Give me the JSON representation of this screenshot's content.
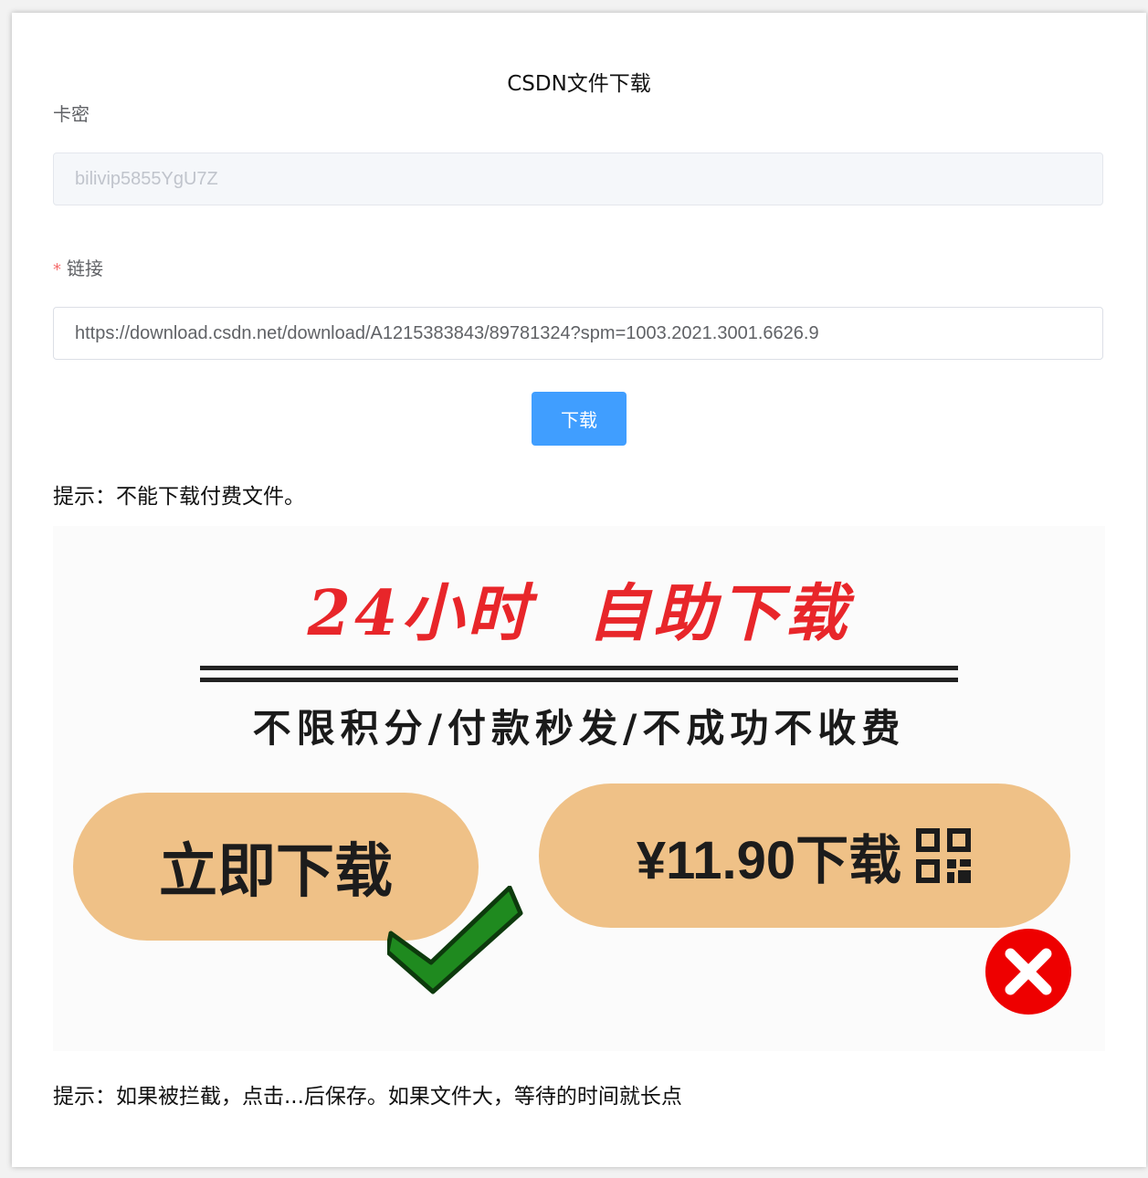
{
  "page_title": "CSDN文件下载",
  "form": {
    "card_key_label": "卡密",
    "card_key_value": "bilivip5855YgU7Z",
    "link_required_mark": "*",
    "link_label": "链接",
    "link_value": "https://download.csdn.net/download/A1215383843/89781324?spm=1003.2021.3001.6626.9",
    "download_button": "下载"
  },
  "hints": {
    "top": "提示：不能下载付费文件。",
    "bottom": "提示：如果被拦截，点击...后保存。如果文件大，等待的时间就长点"
  },
  "banner": {
    "headline_part1": "24小时",
    "headline_part2": "自助下载",
    "subline": "不限积分/付款秒发/不成功不收费",
    "left_pill": "立即下载",
    "right_pill": "¥11.90下载",
    "icons": [
      "check-icon",
      "x-icon",
      "qr-code-icon"
    ],
    "colors": {
      "headline": "#e8262a",
      "pill": "#efc187",
      "check": "#1f8a1f",
      "cross": "#ee0000"
    }
  },
  "colors": {
    "primary_button": "#409eff",
    "required": "#f56c6c"
  }
}
